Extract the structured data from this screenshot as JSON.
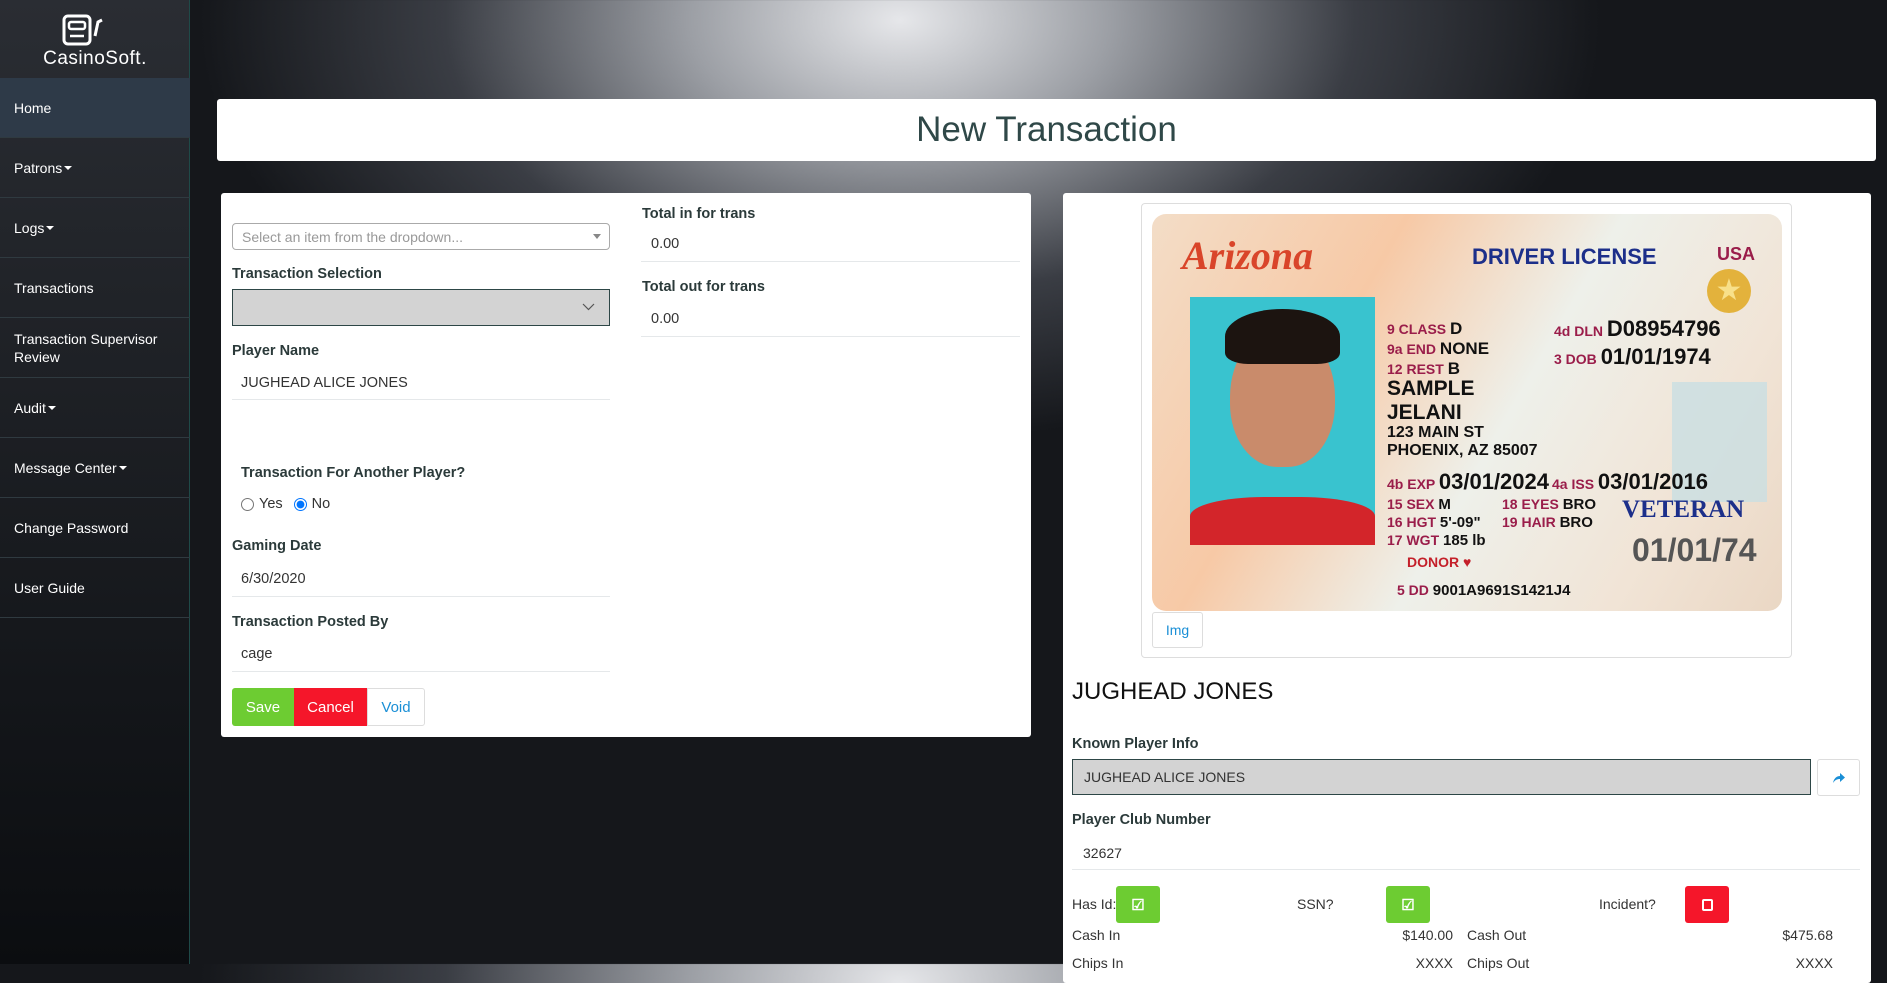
{
  "app": {
    "brand": "CasinoSoft."
  },
  "sidebar": {
    "items": [
      {
        "label": "Home",
        "dropdown": false
      },
      {
        "label": "Patrons",
        "dropdown": true
      },
      {
        "label": "Logs",
        "dropdown": true
      },
      {
        "label": "Transactions",
        "dropdown": false
      },
      {
        "label": "Transaction Supervisor Review",
        "dropdown": false
      },
      {
        "label": "Audit",
        "dropdown": true
      },
      {
        "label": "Message Center",
        "dropdown": true
      },
      {
        "label": "Change Password",
        "dropdown": false
      },
      {
        "label": "User Guide",
        "dropdown": false
      }
    ]
  },
  "header": {
    "title": "New Transaction"
  },
  "form": {
    "dropdown_placeholder": "Select an item from the dropdown...",
    "transaction_selection_label": "Transaction Selection",
    "transaction_selection_value": "",
    "player_name_label": "Player Name",
    "player_name_value": "JUGHEAD ALICE JONES",
    "another_player_label": "Transaction For Another Player?",
    "yes_label": "Yes",
    "no_label": "No",
    "another_player_selected": "No",
    "gaming_date_label": "Gaming Date",
    "gaming_date_value": "6/30/2020",
    "posted_by_label": "Transaction Posted By",
    "posted_by_value": "cage",
    "total_in_label": "Total in for trans",
    "total_in_value": "0.00",
    "total_out_label": "Total out for trans",
    "total_out_value": "0.00",
    "save_label": "Save",
    "cancel_label": "Cancel",
    "void_label": "Void"
  },
  "player": {
    "id_card": {
      "state": "Arizona",
      "type": "DRIVER LICENSE",
      "country": "USA",
      "class": "D",
      "end": "NONE",
      "rest": "B",
      "dln": "D08954796",
      "dob": "01/01/1974",
      "last": "SAMPLE",
      "first": "JELANI",
      "addr1": "123 MAIN ST",
      "addr2": "PHOENIX, AZ 85007",
      "exp": "03/01/2024",
      "iss": "03/01/2016",
      "sex": "M",
      "hgt": "5'-09\"",
      "wgt": "185 lb",
      "eyes": "BRO",
      "hair": "BRO",
      "veteran": "VETERAN",
      "dob_short": "01/01/74",
      "donor": "DONOR",
      "dd": "9001A9691S1421J4"
    },
    "img_button": "Img",
    "display_name": "JUGHEAD JONES",
    "known_info_label": "Known Player Info",
    "known_info_value": "JUGHEAD ALICE JONES",
    "club_label": "Player Club Number",
    "club_value": "32627",
    "has_id_label": "Has Id:",
    "has_id": true,
    "ssn_label": "SSN?",
    "ssn": true,
    "incident_label": "Incident?",
    "incident": false,
    "cash_in_label": "Cash In",
    "cash_in_value": "$140.00",
    "cash_out_label": "Cash Out",
    "cash_out_value": "$475.68",
    "chips_in_label": "Chips In",
    "chips_in_value": "XXXX",
    "chips_out_label": "Chips Out",
    "chips_out_value": "XXXX"
  },
  "colors": {
    "save": "#6dcc32",
    "cancel": "#f5162a",
    "link": "#1a8fd6",
    "nav_active": "#2e3a48"
  }
}
